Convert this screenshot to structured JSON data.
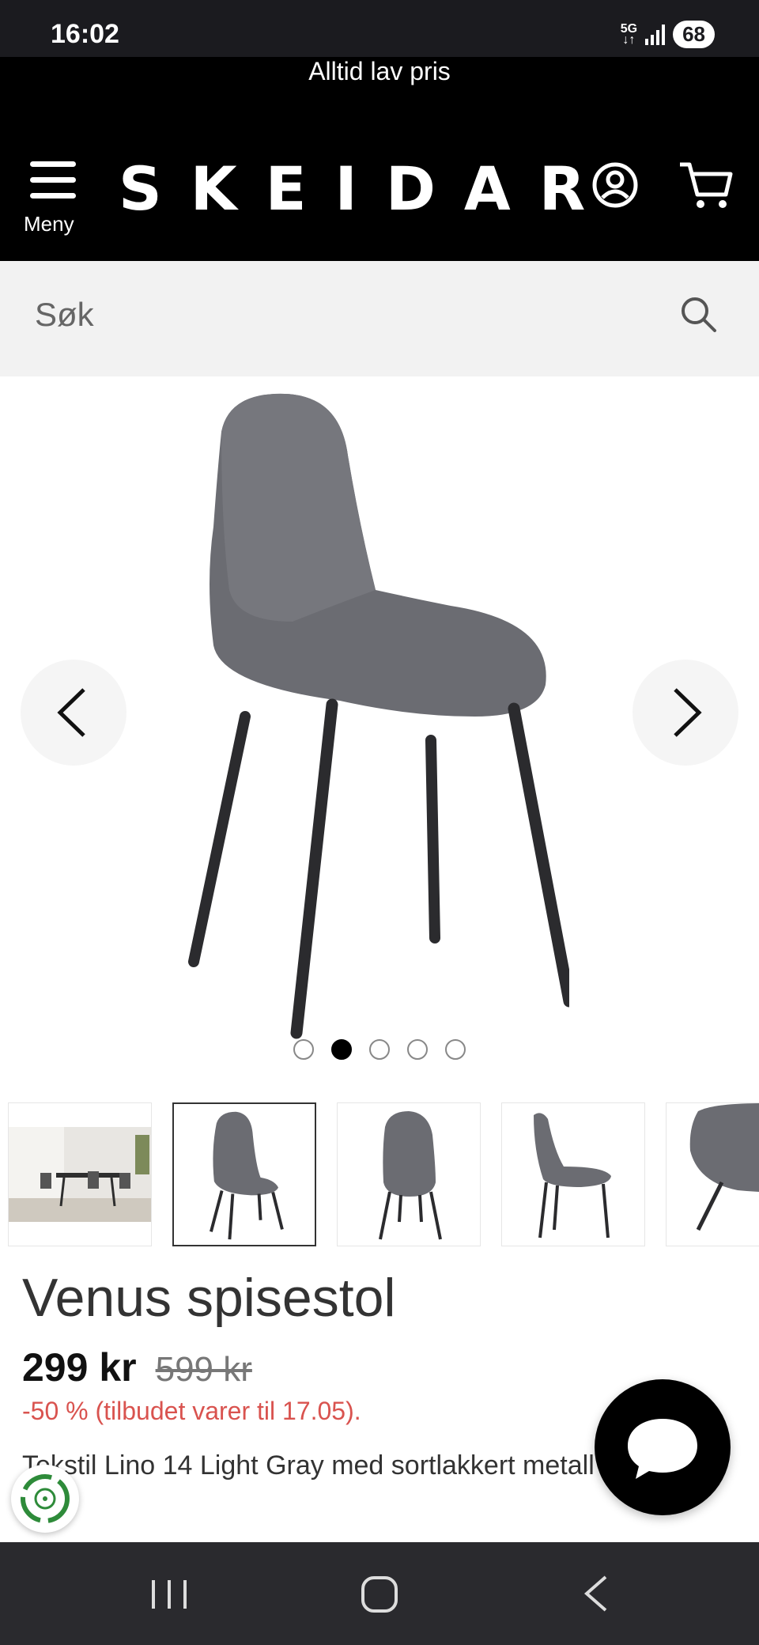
{
  "status_bar": {
    "time": "16:02",
    "network": "5G",
    "battery": "68"
  },
  "header": {
    "promo": "Alltid lav pris",
    "menu_label": "Meny",
    "logo": "SKEIDAR"
  },
  "search": {
    "placeholder": "Søk"
  },
  "gallery": {
    "slide_count": 5,
    "active_slide": 2
  },
  "product": {
    "title": "Venus spisestol",
    "price": "299 kr",
    "old_price": "599 kr",
    "discount": "-50 % (tilbudet varer til 17.05).",
    "description": "Tekstil Lino 14 Light Gray med sortlakkert metall"
  },
  "colors": {
    "brand_black": "#000000",
    "discount_red": "#d9534f",
    "eco_green": "#2e8b3a"
  }
}
